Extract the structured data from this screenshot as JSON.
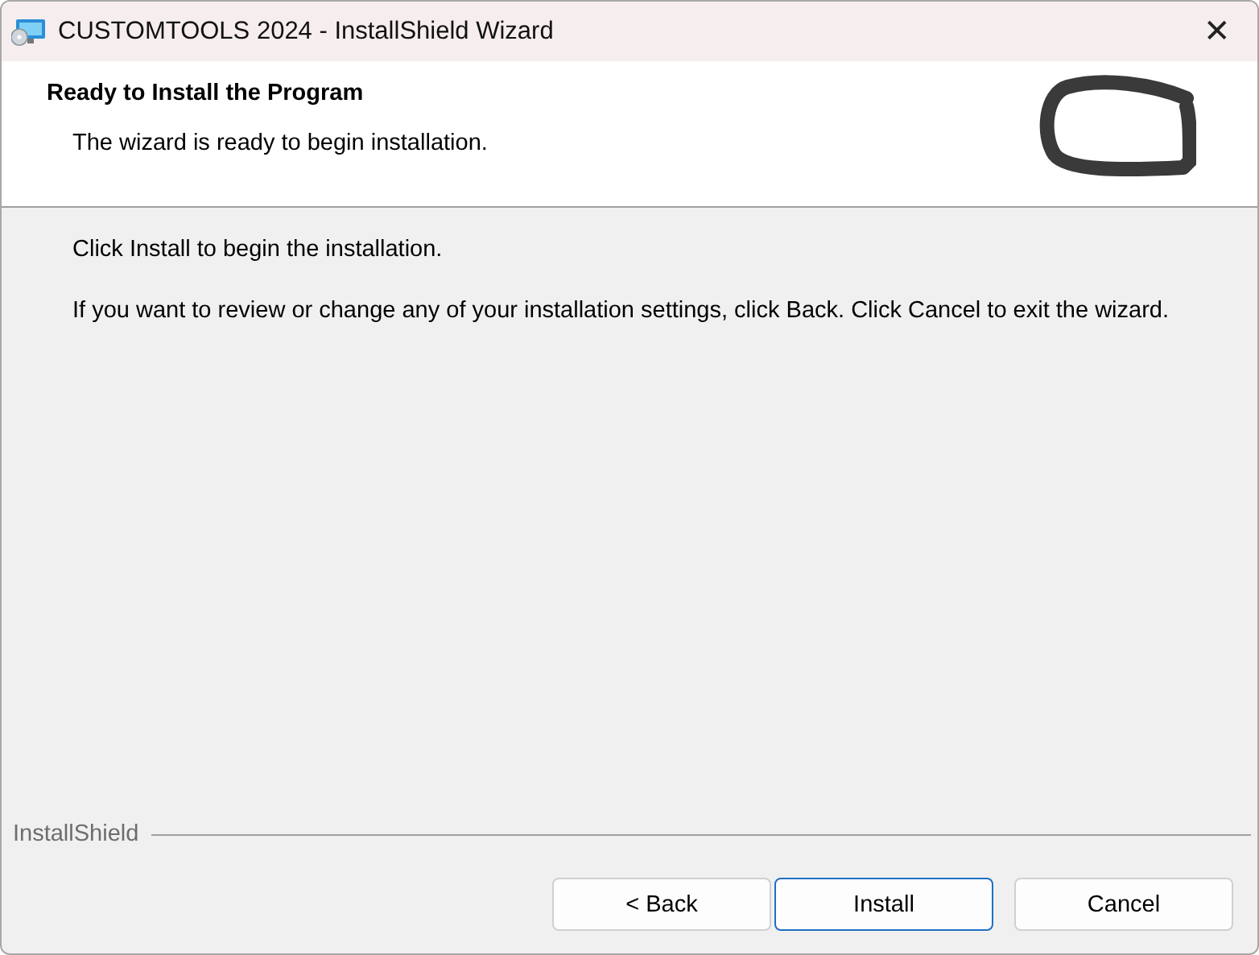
{
  "window": {
    "title": "CUSTOMTOOLS 2024 - InstallShield Wizard",
    "close": "✕"
  },
  "header": {
    "title": "Ready to Install the Program",
    "subtitle": "The wizard is ready to begin installation."
  },
  "body": {
    "paragraphs": [
      "Click Install to begin the installation.",
      "If you want to review or change any of your installation settings, click Back. Click Cancel to exit the wizard."
    ]
  },
  "footer": {
    "brand": "InstallShield",
    "buttons": [
      {
        "label": "< Back",
        "default": false
      },
      {
        "label": "Install",
        "default": true
      },
      {
        "label": "Cancel",
        "default": false
      }
    ]
  }
}
